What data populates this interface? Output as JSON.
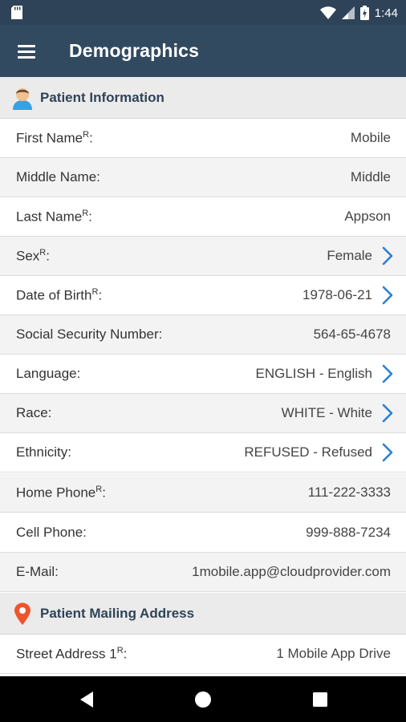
{
  "status_bar": {
    "time": "1:44"
  },
  "app_bar": {
    "title": "Demographics"
  },
  "sections": {
    "patient_info": "Patient Information",
    "mailing_address": "Patient Mailing Address"
  },
  "required_mark": "R",
  "fields": [
    {
      "label": "First Name",
      "value": "Mobile"
    },
    {
      "label": "Middle Name:",
      "value": "Middle"
    },
    {
      "label": "Last Name",
      "value": "Appson"
    },
    {
      "label": "Sex",
      "value": "Female"
    },
    {
      "label": "Date of Birth",
      "value": "1978-06-21"
    },
    {
      "label": "Social Security Number:",
      "value": "564-65-4678"
    },
    {
      "label": "Language:",
      "value": "ENGLISH - English"
    },
    {
      "label": "Race:",
      "value": "WHITE - White"
    },
    {
      "label": "Ethnicity:",
      "value": "REFUSED - Refused"
    },
    {
      "label": "Home Phone",
      "value": "111-222-3333"
    },
    {
      "label": "Cell Phone:",
      "value": "999-888-7234"
    },
    {
      "label": "E-Mail:",
      "value": "1mobile.app@cloudprovider.com"
    }
  ],
  "address_fields": [
    {
      "label": "Street Address 1",
      "value": "1 Mobile App Drive"
    }
  ],
  "colors": {
    "app_bar": "#324a60",
    "status_bar": "#2f4358",
    "accent_chevron": "#2a7fd4",
    "section_bg": "#ebebeb",
    "pin": "#f0542d"
  },
  "icons": [
    "sd-card-icon",
    "wifi-icon",
    "signal-icon",
    "battery-icon",
    "menu-icon",
    "patient-avatar-icon",
    "chevron-right-icon",
    "location-pin-icon",
    "back-icon",
    "home-icon",
    "recents-icon"
  ]
}
